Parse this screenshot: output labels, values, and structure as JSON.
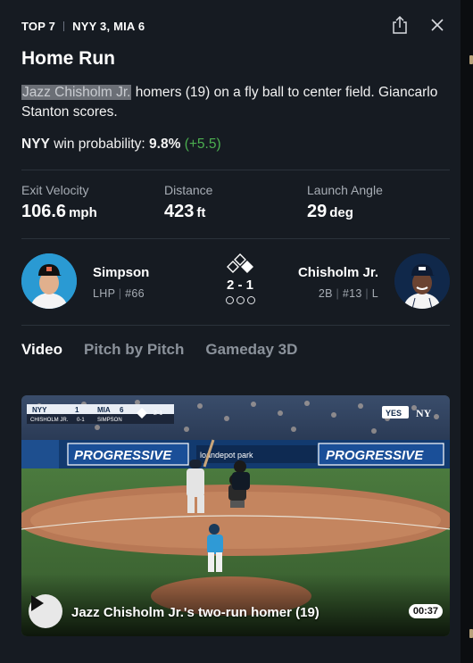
{
  "header": {
    "inning": "TOP 7",
    "score": "NYY 3, MIA 6"
  },
  "play": {
    "title": "Home Run",
    "batter_name": "Jazz Chisholm Jr.",
    "description_rest": " homers (19) on a fly ball to center field. Giancarlo Stanton scores."
  },
  "win_probability": {
    "team": "NYY",
    "label": "win probability:",
    "value": "9.8%",
    "delta": "(+5.5)",
    "delta_color": "#4caf50"
  },
  "stats": [
    {
      "label": "Exit Velocity",
      "value": "106.6",
      "unit": "mph"
    },
    {
      "label": "Distance",
      "value": "423",
      "unit": "ft"
    },
    {
      "label": "Launch Angle",
      "value": "29",
      "unit": "deg"
    }
  ],
  "matchup": {
    "pitcher": {
      "name": "Simpson",
      "hand": "LHP",
      "number": "#66"
    },
    "batter": {
      "name": "Chisholm Jr.",
      "position": "2B",
      "number": "#13",
      "bats": "L"
    },
    "count": "2 - 1"
  },
  "tabs": [
    {
      "label": "Video",
      "active": true
    },
    {
      "label": "Pitch by Pitch",
      "active": false
    },
    {
      "label": "Gameday 3D",
      "active": false
    }
  ],
  "video": {
    "caption": "Jazz Chisholm Jr.'s two-run homer (19)",
    "duration": "00:37",
    "scorebug": {
      "away": "NYY",
      "away_score": "1",
      "home": "MIA",
      "home_score": "6",
      "count": "2-1",
      "batter_line": "CHISHOLM JR.",
      "pitcher_line": "SIMPSON",
      "outs": "0-1"
    },
    "network_logo": "YES",
    "banner_text": "PROGRESSIVE",
    "park_text": "loandepot park"
  }
}
